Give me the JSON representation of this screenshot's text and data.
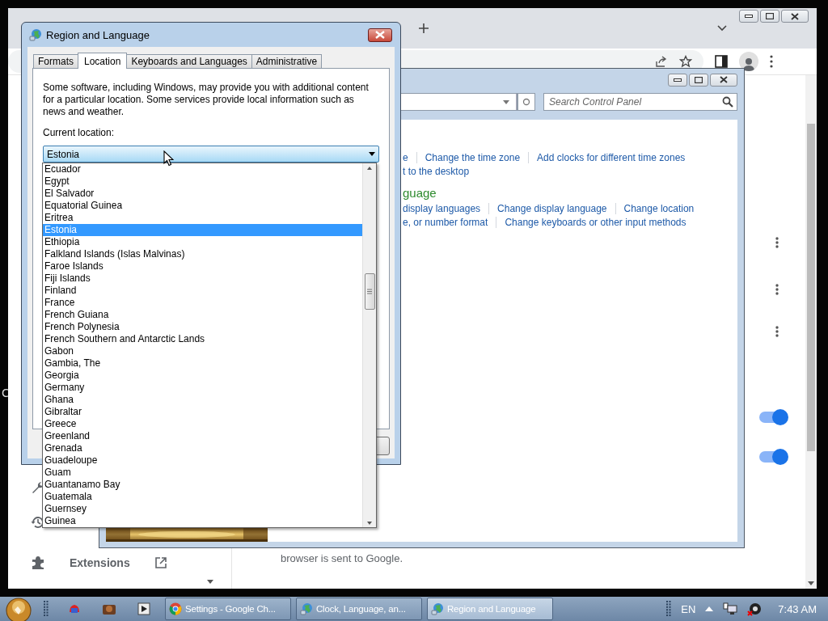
{
  "desktop_text": "C",
  "browser": {
    "sidebar": {
      "items": [
        {
          "label": "Extensions"
        }
      ]
    },
    "content_text": "browser is sent to Google.",
    "toggles": [
      {
        "on": true
      },
      {
        "on": true
      }
    ]
  },
  "control_panel": {
    "search": {
      "placeholder": "Search Control Panel"
    },
    "heading": "guage",
    "link_rows": [
      [
        "e",
        "Change the time zone",
        "Add clocks for different time zones"
      ],
      [
        "t to the desktop"
      ],
      [
        "display languages",
        "Change display language",
        "Change location"
      ],
      [
        "e, or number format",
        "Change keyboards or other input methods"
      ]
    ]
  },
  "dialog": {
    "title": "Region and Language",
    "tabs": [
      {
        "label": "Formats",
        "selected": false
      },
      {
        "label": "Location",
        "selected": true
      },
      {
        "label": "Keyboards and Languages",
        "selected": false
      },
      {
        "label": "Administrative",
        "selected": false
      }
    ],
    "description": "Some software, including Windows, may provide you with additional content for a particular location. Some services provide local information such as news and weather.",
    "location_label": "Current location:",
    "location": {
      "value": "Estonia"
    },
    "dropdown": {
      "items": [
        {
          "label": "Ecuador",
          "selected": false
        },
        {
          "label": "Egypt",
          "selected": false
        },
        {
          "label": "El Salvador",
          "selected": false
        },
        {
          "label": "Equatorial Guinea",
          "selected": false
        },
        {
          "label": "Eritrea",
          "selected": false
        },
        {
          "label": "Estonia",
          "selected": true
        },
        {
          "label": "Ethiopia",
          "selected": false
        },
        {
          "label": "Falkland Islands (Islas Malvinas)",
          "selected": false
        },
        {
          "label": "Faroe Islands",
          "selected": false
        },
        {
          "label": "Fiji Islands",
          "selected": false
        },
        {
          "label": "Finland",
          "selected": false
        },
        {
          "label": "France",
          "selected": false
        },
        {
          "label": "French Guiana",
          "selected": false
        },
        {
          "label": "French Polynesia",
          "selected": false
        },
        {
          "label": "French Southern and Antarctic Lands",
          "selected": false
        },
        {
          "label": "Gabon",
          "selected": false
        },
        {
          "label": "Gambia, The",
          "selected": false
        },
        {
          "label": "Georgia",
          "selected": false
        },
        {
          "label": "Germany",
          "selected": false
        },
        {
          "label": "Ghana",
          "selected": false
        },
        {
          "label": "Gibraltar",
          "selected": false
        },
        {
          "label": "Greece",
          "selected": false
        },
        {
          "label": "Greenland",
          "selected": false
        },
        {
          "label": "Grenada",
          "selected": false
        },
        {
          "label": "Guadeloupe",
          "selected": false
        },
        {
          "label": "Guam",
          "selected": false
        },
        {
          "label": "Guantanamo Bay",
          "selected": false
        },
        {
          "label": "Guatemala",
          "selected": false
        },
        {
          "label": "Guernsey",
          "selected": false
        },
        {
          "label": "Guinea",
          "selected": false
        }
      ]
    }
  },
  "taskbar": {
    "tasks": [
      {
        "label": "Settings - Google Ch...",
        "kind": "chrome",
        "selected": false
      },
      {
        "label": "Clock, Language, an...",
        "kind": "globe",
        "selected": false
      },
      {
        "label": "Region and Language",
        "kind": "globe",
        "selected": true
      }
    ],
    "language": "EN",
    "clock": "7:43 AM"
  }
}
